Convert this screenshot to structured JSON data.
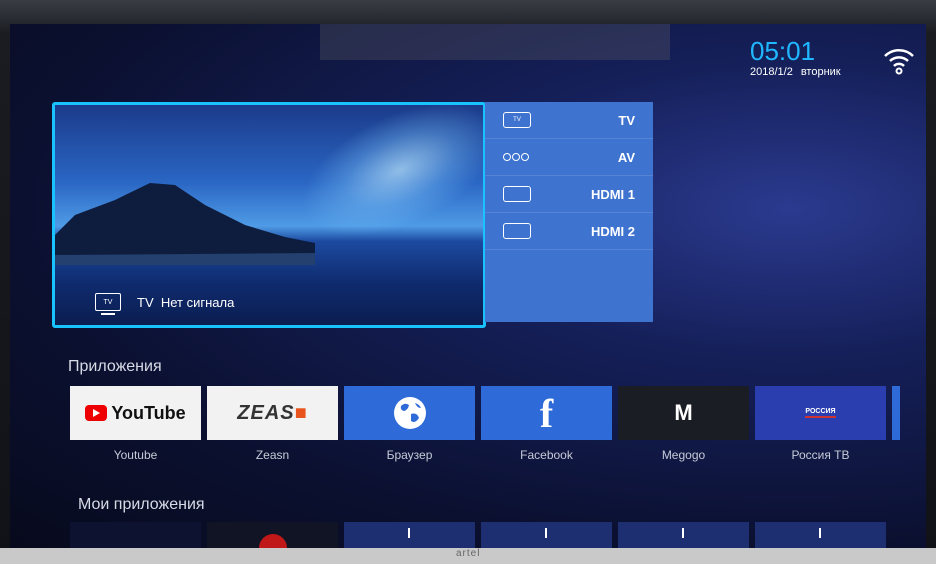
{
  "status": {
    "time": "05:01",
    "date": "2018/1/2",
    "weekday": "вторник"
  },
  "preview": {
    "tv_icon_text": "TV",
    "source": "TV",
    "status_text": "Нет сигнала"
  },
  "sources": [
    {
      "icon": "tv-icon",
      "icon_text": "TV",
      "label": "TV"
    },
    {
      "icon": "av-icon",
      "label": "AV"
    },
    {
      "icon": "hdmi-icon",
      "label": "HDMI 1"
    },
    {
      "icon": "hdmi-icon",
      "label": "HDMI 2"
    }
  ],
  "apps_section": {
    "title": "Приложения",
    "items": [
      {
        "name": "Youtube",
        "logo_text": "YouTube"
      },
      {
        "name": "Zeasn",
        "logo_text": "ZEAS"
      },
      {
        "name": "Браузер",
        "icon": "globe-icon"
      },
      {
        "name": "Facebook",
        "logo_text": "f"
      },
      {
        "name": "Megogo",
        "logo_text": "M"
      },
      {
        "name": "Россия ТВ",
        "logo_text": "РОССИЯ"
      }
    ]
  },
  "my_apps_section": {
    "title": "Мои приложения"
  },
  "colors": {
    "accent": "#19c3ff",
    "source_panel": "#3e73cf",
    "clock": "#1fb7ff"
  },
  "brand": "artel"
}
